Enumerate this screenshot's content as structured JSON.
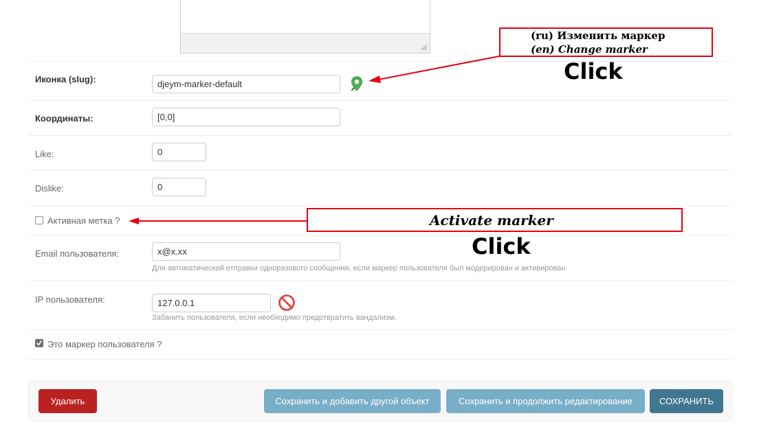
{
  "form": {
    "icon": {
      "label": "Иконка (slug):",
      "value": "djeym-marker-default"
    },
    "coordinates": {
      "label": "Координаты:",
      "value": "[0,0]"
    },
    "like": {
      "label": "Like:",
      "value": "0"
    },
    "dislike": {
      "label": "Dislike:",
      "value": "0"
    },
    "active": {
      "label": "Активная метка ?",
      "checked": false
    },
    "email": {
      "label": "Email пользователя:",
      "value": "x@x.xx",
      "help": "Для автоматической отправки одноразового сообщения, если маркер пользователя был модерирован и активирован."
    },
    "ip": {
      "label": "IP пользователя:",
      "value": "127.0.0.1",
      "help": "Забанить пользователя, если необходимо предотвратить вандализм."
    },
    "user_marker": {
      "label": "Это маркер пользователя ?",
      "checked": true
    }
  },
  "buttons": {
    "delete": "Удалить",
    "save_add": "Сохранить и добавить другой объект",
    "save_continue": "Сохранить и продолжить редактирование",
    "save": "СОХРАНИТЬ"
  },
  "annotations": {
    "change_marker_ru": "(ru) Изменить маркер",
    "change_marker_en": "(en) Change marker",
    "click_1": "Click",
    "activate_marker": "Activate marker",
    "click_2": "Click"
  },
  "icons": {
    "marker": "map-marker-icon",
    "ban": "ban-icon",
    "resize": "resize-grip-icon"
  },
  "colors": {
    "marker_green": "#4caf50",
    "ban_red": "#e53935",
    "delete_red": "#ba2121",
    "save_light_blue": "#79aec8",
    "save_dark_blue": "#417690",
    "annotation_red": "#e8000d"
  }
}
